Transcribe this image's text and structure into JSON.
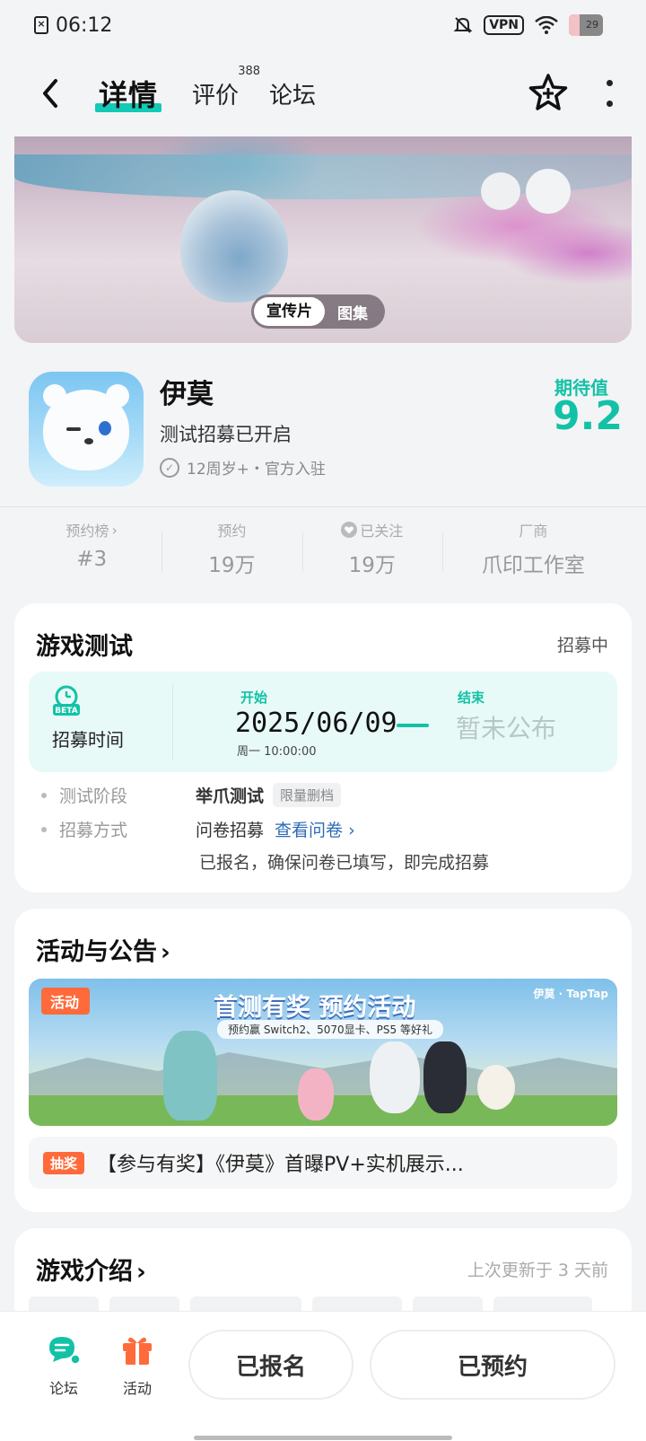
{
  "status_bar": {
    "time": "06:12",
    "vpn": "VPN",
    "battery": "29"
  },
  "header": {
    "tabs": [
      {
        "label": "详情",
        "active": true
      },
      {
        "label": "评价",
        "count": "388"
      },
      {
        "label": "论坛"
      }
    ]
  },
  "banner": {
    "toggle_active": "宣传片",
    "toggle_inactive": "图集"
  },
  "game": {
    "name": "伊莫",
    "status": "测试招募已开启",
    "meta": "12周岁+・官方入驻",
    "expect_label": "期待值",
    "expect_value": "9.2"
  },
  "stats": [
    {
      "label": "预约榜",
      "value": "#3",
      "has_chevron": true
    },
    {
      "label": "预约",
      "value": "19万"
    },
    {
      "label": "已关注",
      "value": "19万",
      "icon": "heart-icon"
    },
    {
      "label": "厂商",
      "value": "爪印工作室"
    }
  ],
  "test_card": {
    "title": "游戏测试",
    "state": "招募中",
    "recruit_label": "招募时间",
    "start_label": "开始",
    "start_date": "2025/06/09",
    "start_time": "周一   10:00:00",
    "end_label": "结束",
    "end_value": "暂未公布",
    "stage_key": "测试阶段",
    "stage_value": "举爪测试",
    "stage_tag": "限量删档",
    "method_key": "招募方式",
    "method_value": "问卷招募",
    "method_link": "查看问卷",
    "note": "已报名，确保问卷已填写，即完成招募"
  },
  "activity_card": {
    "title": "活动与公告",
    "banner_badge": "活动",
    "banner_headline": "首测有奖 预约活动",
    "banner_sub": "预约赢 Switch2、5070显卡、PS5 等好礼",
    "banner_brand": "伊莫 · TapTap",
    "lottery_badge": "抽奖",
    "lottery_text": "【参与有奖】《伊莫》首曝PV+实机展示..."
  },
  "intro_card": {
    "title": "游戏介绍",
    "updated": "上次更新于 3 天前"
  },
  "bottom_bar": {
    "nav": [
      {
        "label": "论坛",
        "icon": "forum-icon"
      },
      {
        "label": "活动",
        "icon": "gift-icon"
      }
    ],
    "signup_button": "已报名",
    "reserve_button": "已预约"
  },
  "colors": {
    "accent": "#13c2a6",
    "activity": "#ff6a3a",
    "link": "#2d6cb5"
  }
}
